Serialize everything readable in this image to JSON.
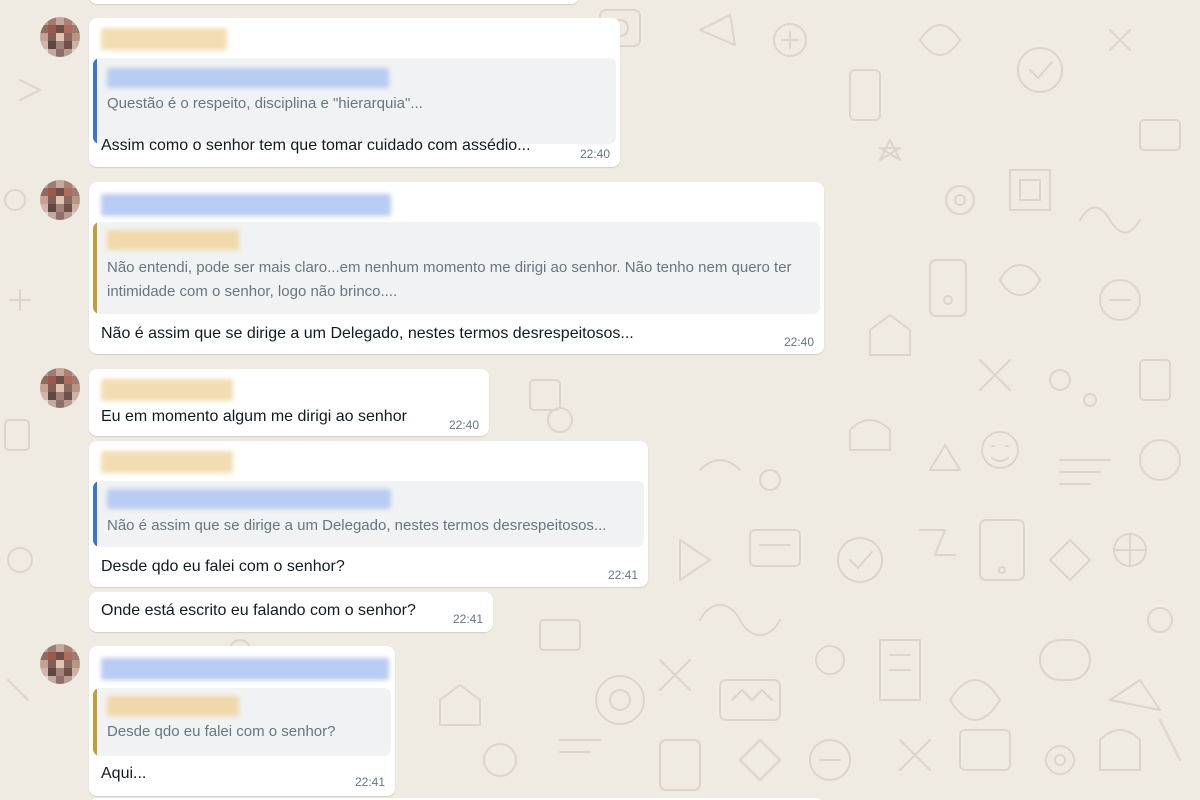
{
  "messages": [
    {
      "quote": {
        "text": "Questão é o respeito, disciplina e \"hierarquia\"..."
      },
      "text": "Assim como o senhor tem que tomar cuidado com assédio...",
      "time": "22:40"
    },
    {
      "quote": {
        "text": "Não entendi, pode ser mais claro...em nenhum momento me dirigi ao senhor. Não tenho nem quero ter intimidade com o senhor, logo não brinco...."
      },
      "text": "Não é assim que se dirige a um Delegado, nestes termos desrespeitosos...",
      "time": "22:40"
    },
    {
      "text": "Eu em momento algum me dirigi ao senhor",
      "time": "22:40"
    },
    {
      "quote": {
        "text": "Não é assim que se dirige a um Delegado, nestes termos desrespeitosos..."
      },
      "text": "Desde qdo eu falei com o senhor?",
      "time": "22:41"
    },
    {
      "text": "Onde está escrito eu falando com o senhor?",
      "time": "22:41"
    },
    {
      "quote": {
        "text": "Desde qdo eu falei com o senhor?"
      },
      "text": "Aqui...",
      "time": "22:41"
    }
  ],
  "colors": {
    "chat_background": "#efeae2",
    "bubble": "#ffffff",
    "quote_background": "#f1f2f3",
    "quote_bar_blue": "#3e73d6",
    "quote_bar_gold": "#c39c3b",
    "timestamp": "#667781"
  }
}
